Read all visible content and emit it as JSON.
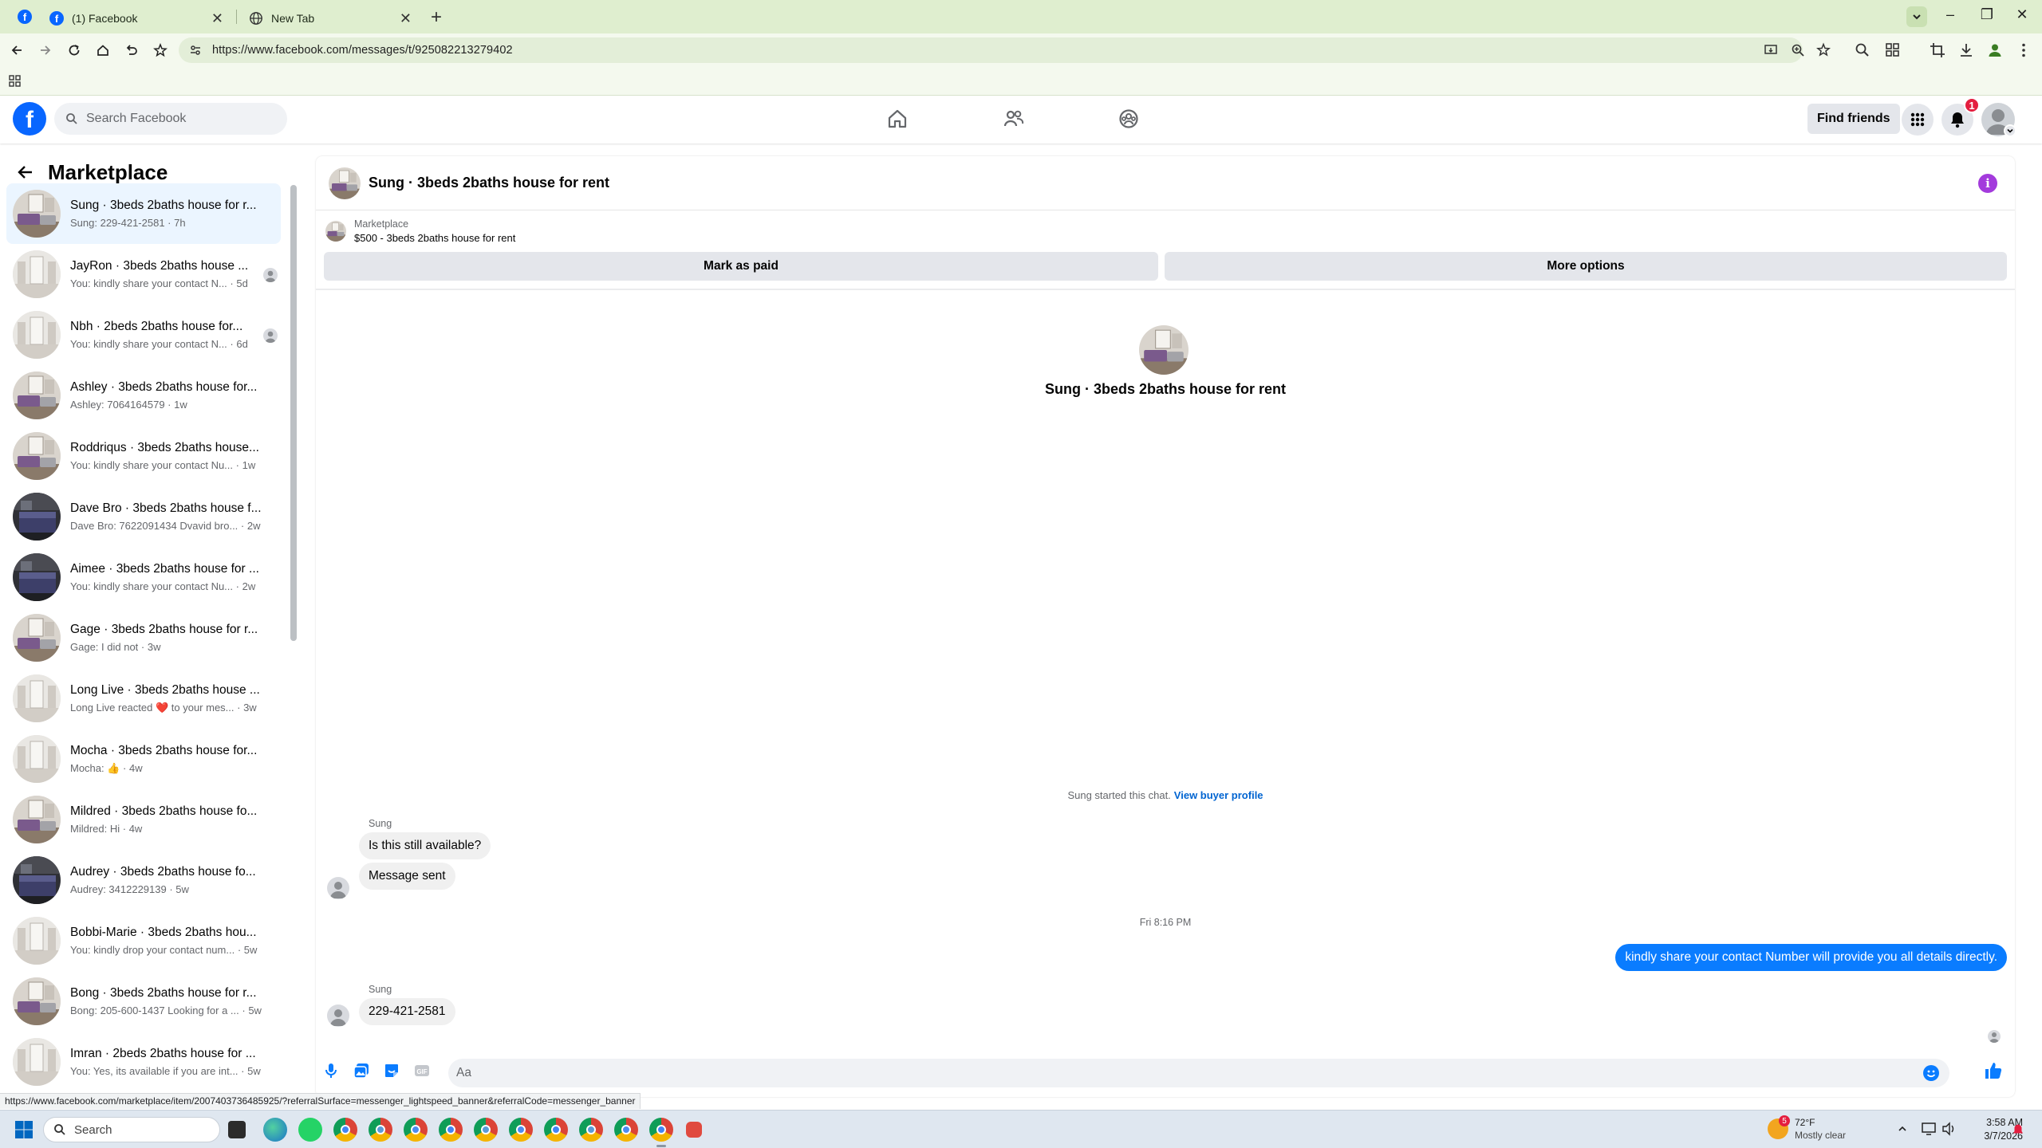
{
  "browser": {
    "tabs": [
      {
        "title": "(1) Facebook",
        "active": false
      },
      {
        "title": "New Tab",
        "active": false
      }
    ],
    "url": "https://www.facebook.com/messages/t/925082213279402",
    "status_url": "https://www.facebook.com/marketplace/item/2007403736485925/?referralSurface=messenger_lightspeed_banner&referralCode=messenger_banner"
  },
  "fb": {
    "search_placeholder": "Search Facebook",
    "find_friends": "Find friends",
    "notification_count": "1",
    "brand_color": "#0866ff"
  },
  "sidebar": {
    "title": "Marketplace",
    "conversations": [
      {
        "name": "Sung · 3beds 2baths house for r...",
        "snippet": "Sung: 229-421-2581",
        "time": "7h",
        "active": true,
        "thumb": "living"
      },
      {
        "name": "JayRon · 3beds 2baths house ...",
        "snippet": "You: kindly share your contact N...",
        "time": "5d",
        "seen": true,
        "thumb": "white"
      },
      {
        "name": "Nbh · 2beds 2baths house for...",
        "snippet": "You: kindly share your contact N...",
        "time": "6d",
        "seen": true,
        "thumb": "white"
      },
      {
        "name": "Ashley · 3beds 2baths house for...",
        "snippet": "Ashley: 7064164579",
        "time": "1w",
        "thumb": "living"
      },
      {
        "name": "Roddriqus · 3beds 2baths house...",
        "snippet": "You: kindly share your contact Nu...",
        "time": "1w",
        "thumb": "living"
      },
      {
        "name": "Dave Bro · 3beds 2baths house f...",
        "snippet": "Dave Bro: 7622091434 Dvavid bro...",
        "time": "2w",
        "thumb": "bedroom"
      },
      {
        "name": "Aimee · 3beds 2baths house for ...",
        "snippet": "You: kindly share your contact Nu...",
        "time": "2w",
        "thumb": "bedroom"
      },
      {
        "name": "Gage · 3beds 2baths house for r...",
        "snippet": "Gage: I did not",
        "time": "3w",
        "thumb": "living"
      },
      {
        "name": "Long Live · 3beds 2baths house ...",
        "snippet": "Long Live reacted ❤️ to your mes...",
        "time": "3w",
        "thumb": "white"
      },
      {
        "name": "Mocha · 3beds 2baths house for...",
        "snippet": "Mocha: 👍",
        "time": "4w",
        "thumb": "white"
      },
      {
        "name": "Mildred · 3beds 2baths house fo...",
        "snippet": "Mildred: Hi",
        "time": "4w",
        "thumb": "living"
      },
      {
        "name": "Audrey · 3beds 2baths house fo...",
        "snippet": "Audrey: 3412229139",
        "time": "5w",
        "thumb": "bedroom"
      },
      {
        "name": "Bobbi-Marie · 3beds 2baths hou...",
        "snippet": "You: kindly drop your contact num...",
        "time": "5w",
        "thumb": "white"
      },
      {
        "name": "Bong · 3beds 2baths house for r...",
        "snippet": "Bong: 205-600-1437 Looking for a ...",
        "time": "5w",
        "thumb": "living"
      },
      {
        "name": "Imran · 2beds 2baths house for ...",
        "snippet": "You: Yes, its available if you are int...",
        "time": "5w",
        "thumb": "white"
      }
    ]
  },
  "chat": {
    "title": "Sung · 3beds 2baths house for rent",
    "listing_label": "Marketplace",
    "listing_detail": "$500 - 3beds 2baths house for rent",
    "mark_paid": "Mark as paid",
    "more_options": "More options",
    "intro_title": "Sung · 3beds 2baths house for rent",
    "started_text": "Sung started this chat.",
    "view_profile": "View buyer profile",
    "sender1": "Sung",
    "msg1": "Is this still available?",
    "msg2": "Message sent",
    "timestamp": "Fri 8:16 PM",
    "msg_out": "kindly share your contact Number will provide you all details directly.",
    "sender2": "Sung",
    "msg3": "229-421-2581",
    "composer_placeholder": "Aa",
    "accent": "#0a7cff"
  },
  "taskbar": {
    "search_placeholder": "Search",
    "weather_alert": "5",
    "temp": "72°F",
    "condition": "Mostly clear",
    "time": "3:58 AM",
    "date": "3/7/2026"
  }
}
